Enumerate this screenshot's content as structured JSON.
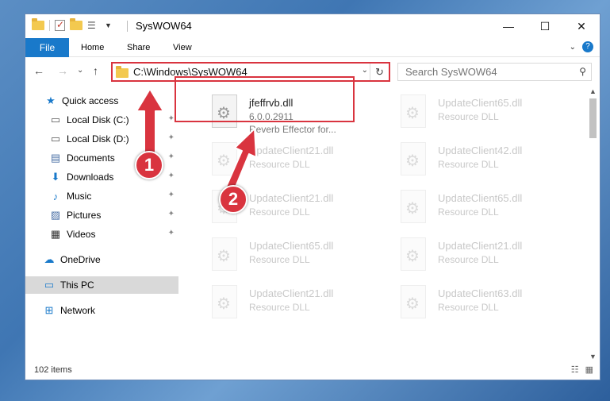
{
  "window": {
    "title": "SysWOW64",
    "controls": {
      "minimize": "—",
      "maximize": "☐",
      "close": "✕"
    }
  },
  "ribbon": {
    "tabs": [
      {
        "label": "File"
      },
      {
        "label": "Home"
      },
      {
        "label": "Share"
      },
      {
        "label": "View"
      }
    ],
    "expand_glyph": "⌄",
    "help_glyph": "?"
  },
  "navigation": {
    "back_glyph": "←",
    "forward_glyph": "→",
    "recent_glyph": "⌄",
    "up_glyph": "↑",
    "address": "C:\\Windows\\SysWOW64",
    "address_drop_glyph": "⌄",
    "refresh_glyph": "↻",
    "search_placeholder": "Search SysWOW64",
    "search_glyph": "⚲"
  },
  "sidebar": {
    "items": [
      {
        "label": "Quick access",
        "icon": "star-icon",
        "glyph": "★",
        "color": "#1979ca"
      },
      {
        "label": "Local Disk (C:)",
        "icon": "drive-icon",
        "glyph": "▭",
        "color": "#555555",
        "pinned": true
      },
      {
        "label": "Local Disk (D:)",
        "icon": "drive-icon",
        "glyph": "▭",
        "color": "#555555",
        "pinned": true
      },
      {
        "label": "Documents",
        "icon": "documents-icon",
        "glyph": "▤",
        "color": "#4a6fa5",
        "pinned": true
      },
      {
        "label": "Downloads",
        "icon": "download-icon",
        "glyph": "⬇",
        "color": "#1979ca",
        "pinned": true
      },
      {
        "label": "Music",
        "icon": "music-icon",
        "glyph": "♪",
        "color": "#1979ca",
        "pinned": true
      },
      {
        "label": "Pictures",
        "icon": "pictures-icon",
        "glyph": "▨",
        "color": "#4a6fa5",
        "pinned": true
      },
      {
        "label": "Videos",
        "icon": "videos-icon",
        "glyph": "▦",
        "color": "#333333",
        "pinned": true
      },
      {
        "label": "OneDrive",
        "icon": "cloud-icon",
        "glyph": "☁",
        "color": "#1979ca"
      },
      {
        "label": "This PC",
        "icon": "computer-icon",
        "glyph": "▭",
        "color": "#1979ca",
        "selected": true
      },
      {
        "label": "Network",
        "icon": "network-icon",
        "glyph": "⊞",
        "color": "#1979ca"
      }
    ],
    "pin_glyph": "📌"
  },
  "files": [
    {
      "name": "jfeffrvb.dll",
      "line2": "6.0.0.2911",
      "line3": "Reverb Effector for...",
      "faded": false
    },
    {
      "name": "UpdateClient65.dll",
      "line2": "Resource DLL",
      "faded": true
    },
    {
      "name": "UpdateClient21.dll",
      "line2": "Resource DLL",
      "faded": true
    },
    {
      "name": "UpdateClient42.dll",
      "line2": "Resource DLL",
      "faded": true
    },
    {
      "name": "UpdateClient21.dll",
      "line2": "Resource DLL",
      "faded": true
    },
    {
      "name": "UpdateClient65.dll",
      "line2": "Resource DLL",
      "faded": true
    },
    {
      "name": "UpdateClient65.dll",
      "line2": "Resource DLL",
      "faded": true
    },
    {
      "name": "UpdateClient21.dll",
      "line2": "Resource DLL",
      "faded": true
    },
    {
      "name": "UpdateClient21.dll",
      "line2": "Resource DLL",
      "faded": true
    },
    {
      "name": "UpdateClient63.dll",
      "line2": "Resource DLL",
      "faded": true
    }
  ],
  "status": {
    "item_count": "102 items"
  },
  "annotations": {
    "callout_1": "1",
    "callout_2": "2",
    "accent_color": "#d9343f"
  }
}
